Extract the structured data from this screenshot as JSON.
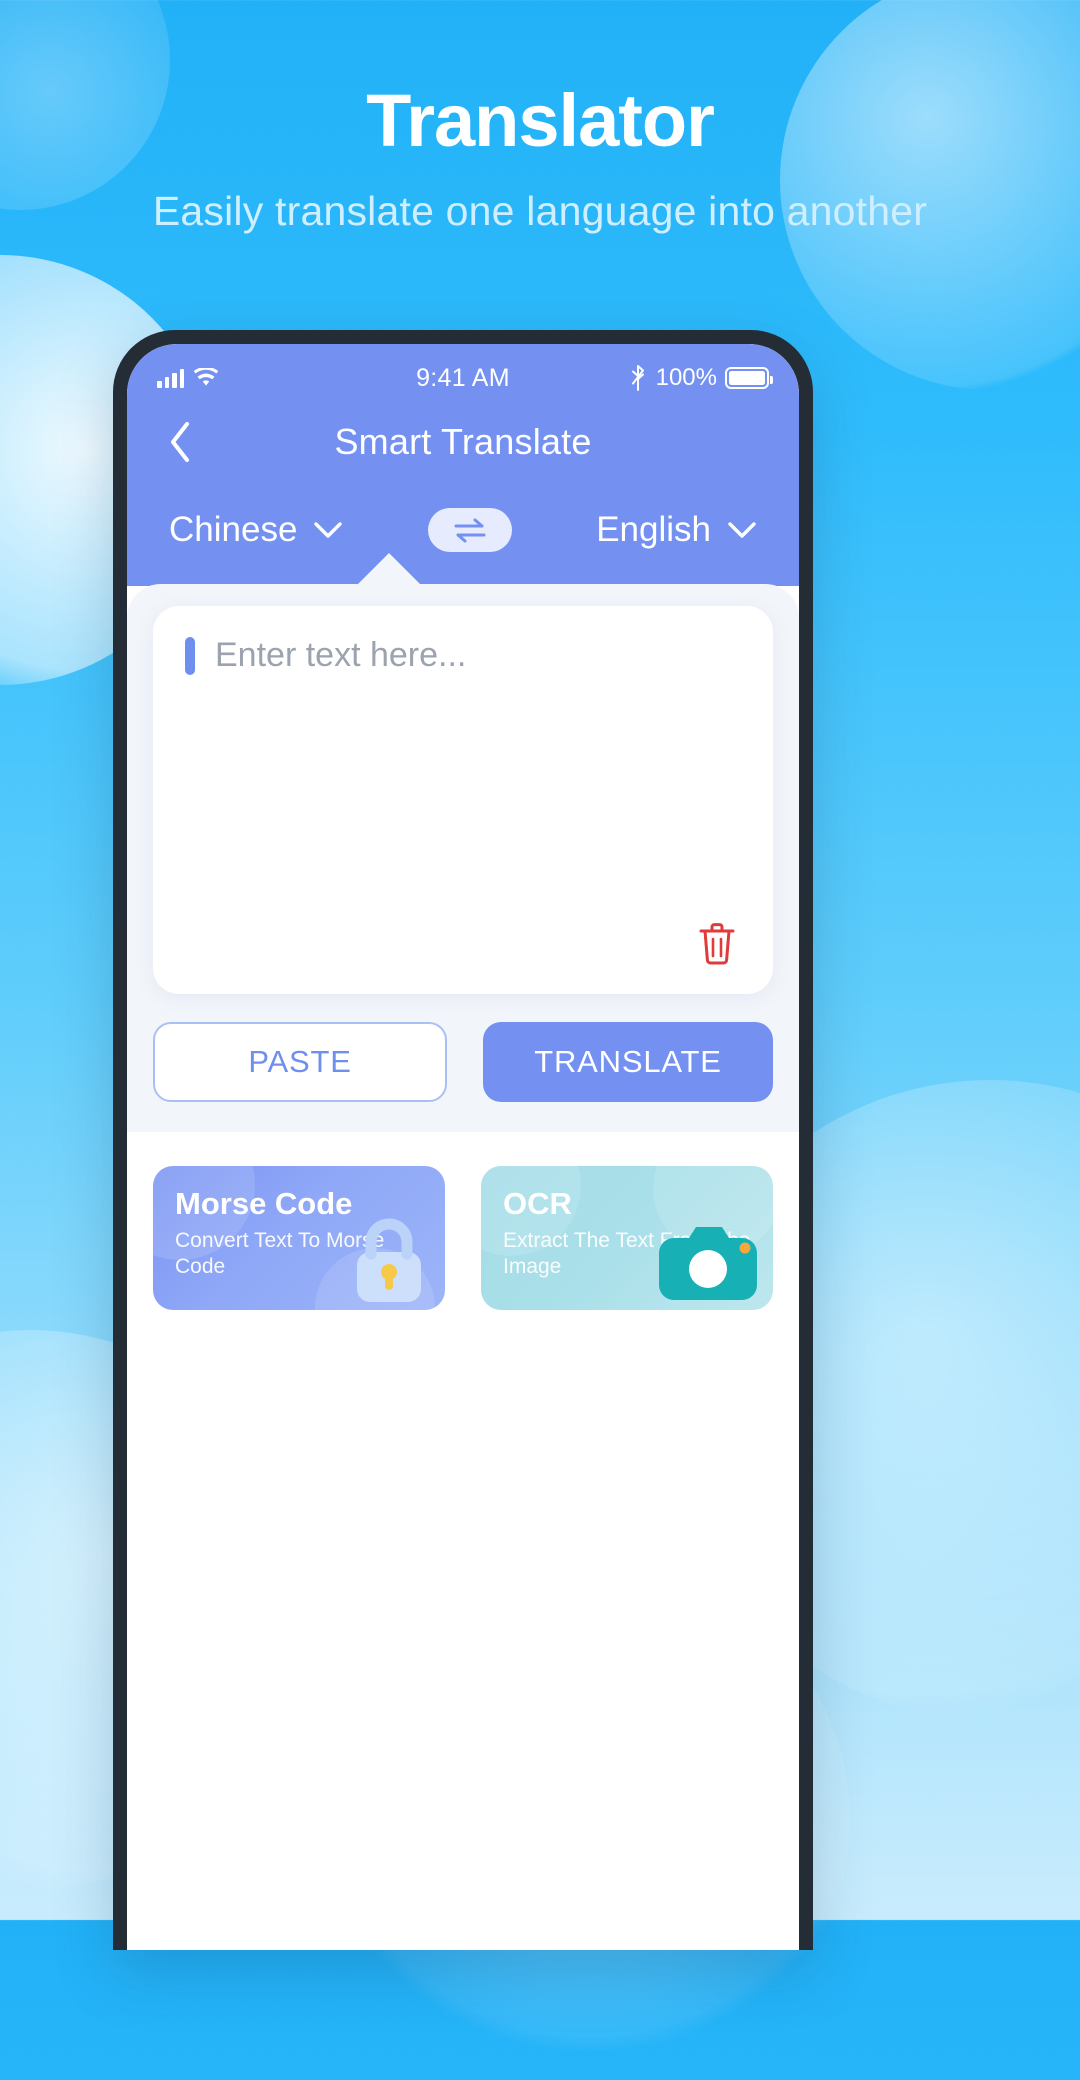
{
  "promo": {
    "title": "Translator",
    "subtitle": "Easily translate one language into another"
  },
  "colors": {
    "bg_top": "#22b1f7",
    "bg_bottom": "#c9ecfd",
    "app_header": "#7491f2",
    "accent": "#6f8ff0",
    "panel": "#f2f5fa",
    "trash": "#e03a3a",
    "ocr_card": "#a5dce6",
    "lock_key": "#f7c948"
  },
  "phone": {
    "statusbar": {
      "signal_icon": "cellular-bars-icon",
      "wifi_icon": "wifi-icon",
      "time": "9:41 AM",
      "bluetooth_icon": "bluetooth-icon",
      "battery_percent": "100%",
      "battery_icon": "battery-full-icon"
    },
    "navbar": {
      "back_icon": "chevron-left-icon",
      "title": "Smart Translate"
    },
    "languages": {
      "source": "Chinese",
      "target": "English",
      "source_chevron_icon": "chevron-down-icon",
      "target_chevron_icon": "chevron-down-icon",
      "swap_icon": "swap-arrows-icon"
    },
    "input": {
      "placeholder": "Enter text here...",
      "value": "",
      "clear_icon": "trash-icon"
    },
    "actions": {
      "paste_label": "PASTE",
      "translate_label": "TRANSLATE"
    },
    "features": [
      {
        "title": "Morse Code",
        "subtitle": "Convert Text To Morse Code",
        "icon": "lock-icon",
        "locked": true
      },
      {
        "title": "OCR",
        "subtitle": "Extract The Text From The Image",
        "icon": "camera-icon",
        "locked": false
      }
    ]
  }
}
